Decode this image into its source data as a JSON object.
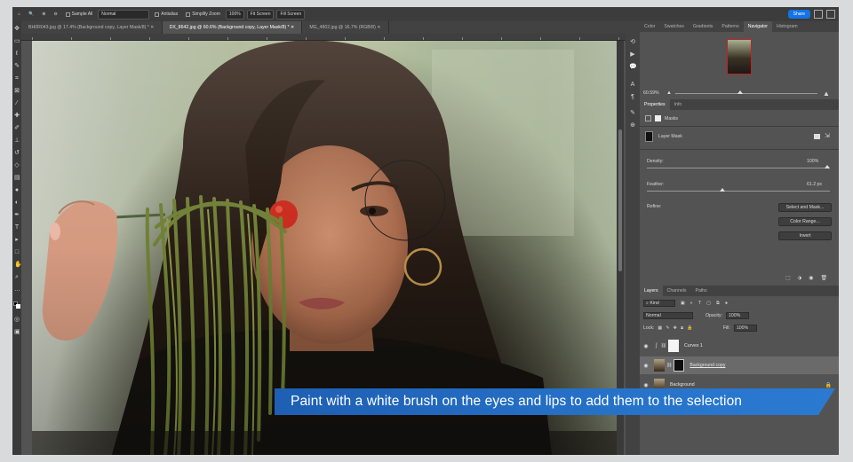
{
  "options_bar": {
    "sample_label": "Sample All",
    "mode_value": "Normal",
    "antialias_label": "Antialias",
    "simplify_zoom_label": "Simplify Zoom",
    "zoom_value": "100%",
    "fit_screen_label": "Fit Screen",
    "fill_screen_label": "Fill Screen",
    "share_label": "Share"
  },
  "tabs": [
    {
      "label": "BH0R043.jpg @ 17.4% (Background copy, Layer Mask/8) *"
    },
    {
      "label": "DX_8642.jpg @ 60.6% (Background copy, Layer Mask/8) *"
    },
    {
      "label": "MG_4802.jpg @ 16.7% (RGB/8)"
    }
  ],
  "panels": {
    "top_tabs": [
      "Color",
      "Swatches",
      "Gradients",
      "Patterns",
      "Navigator",
      "Histogram"
    ],
    "navigator_zoom": "60.59%",
    "properties_tabs": [
      "Properties",
      "Info"
    ],
    "masks_label": "Masks",
    "layer_mask_label": "Layer Mask",
    "density_label": "Density:",
    "density_value": "100%",
    "feather_label": "Feather:",
    "feather_value": "61.2 px",
    "refine_label": "Refine:",
    "refine_buttons": [
      "Select and Mask...",
      "Color Range...",
      "Invert"
    ],
    "layers_tabs": [
      "Layers",
      "Channels",
      "Paths"
    ],
    "kind_label": "Kind",
    "blend_mode": "Normal",
    "opacity_label": "Opacity:",
    "opacity_value": "100%",
    "lock_label": "Lock:",
    "fill_label": "Fill:",
    "fill_value": "100%",
    "layers": [
      {
        "name": "Curves 1"
      },
      {
        "name": "Background copy"
      },
      {
        "name": "Background"
      }
    ]
  },
  "caption": "Paint with a white brush on the eyes and lips to add them to the selection",
  "colors": {
    "accent": "#1473e6",
    "caption_bg": "#2672c9",
    "panel_bg": "#535353"
  }
}
